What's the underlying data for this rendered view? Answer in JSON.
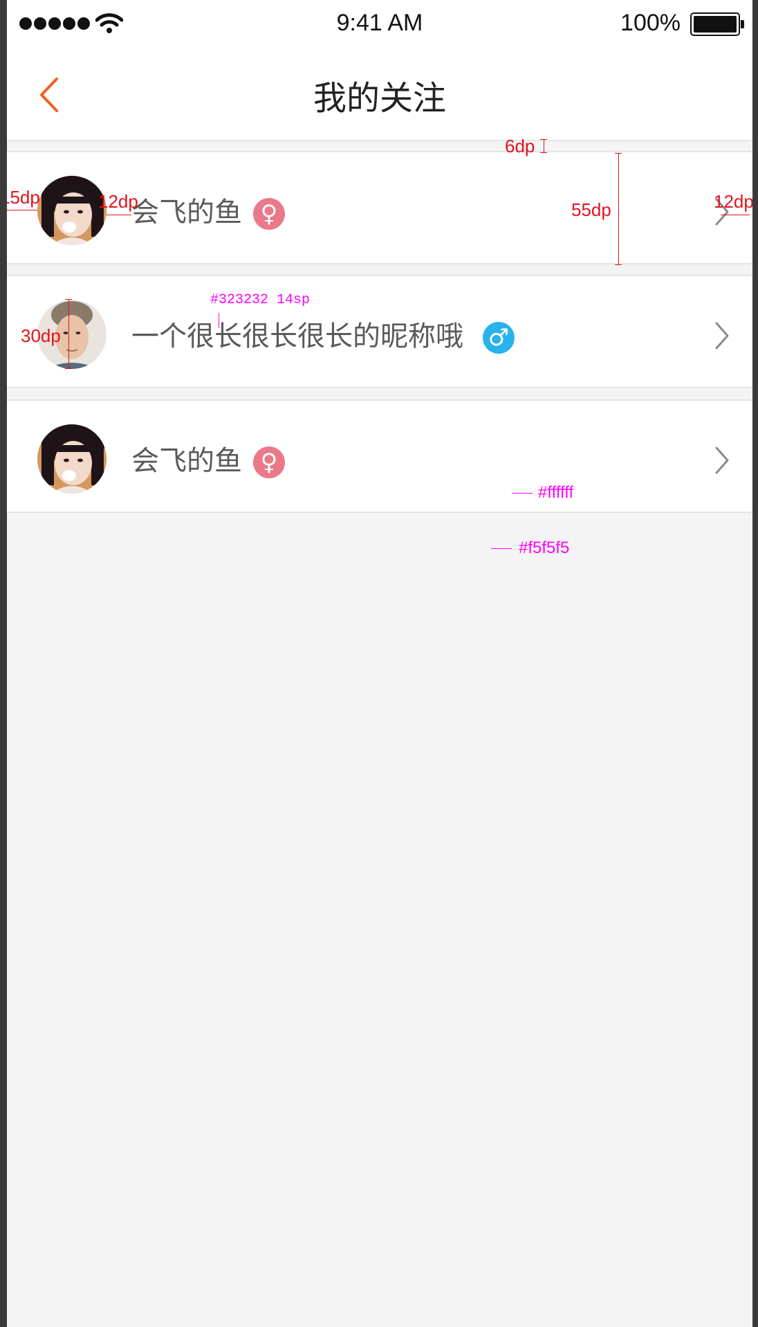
{
  "status_bar": {
    "time": "9:41 AM",
    "battery": "100%"
  },
  "nav": {
    "title": "我的关注"
  },
  "list": [
    {
      "nickname": "会飞的鱼",
      "gender": "female",
      "gender_symbol": "♀",
      "gender_color": "#ea7989"
    },
    {
      "nickname": "一个很长很长很长的昵称哦",
      "gender": "male",
      "gender_symbol": "♂",
      "gender_color": "#29b2ec"
    },
    {
      "nickname": "会飞的鱼",
      "gender": "female",
      "gender_symbol": "♀",
      "gender_color": "#ea7989"
    }
  ],
  "annotations": {
    "gap": "6dp",
    "row_height": "55dp",
    "left_margin": "15dp",
    "avatar_gap": "12dp",
    "right_margin": "12dp",
    "avatar_size": "30dp",
    "text_style": "#323232 14sp",
    "row_color": "#ffffff",
    "bg_color": "#f5f5f5"
  },
  "colors": {
    "accent": "#f06020",
    "text": "#323232",
    "background": "#f4f4f4",
    "annotation_red": "#e2141e",
    "annotation_magenta": "#ff00ff"
  }
}
